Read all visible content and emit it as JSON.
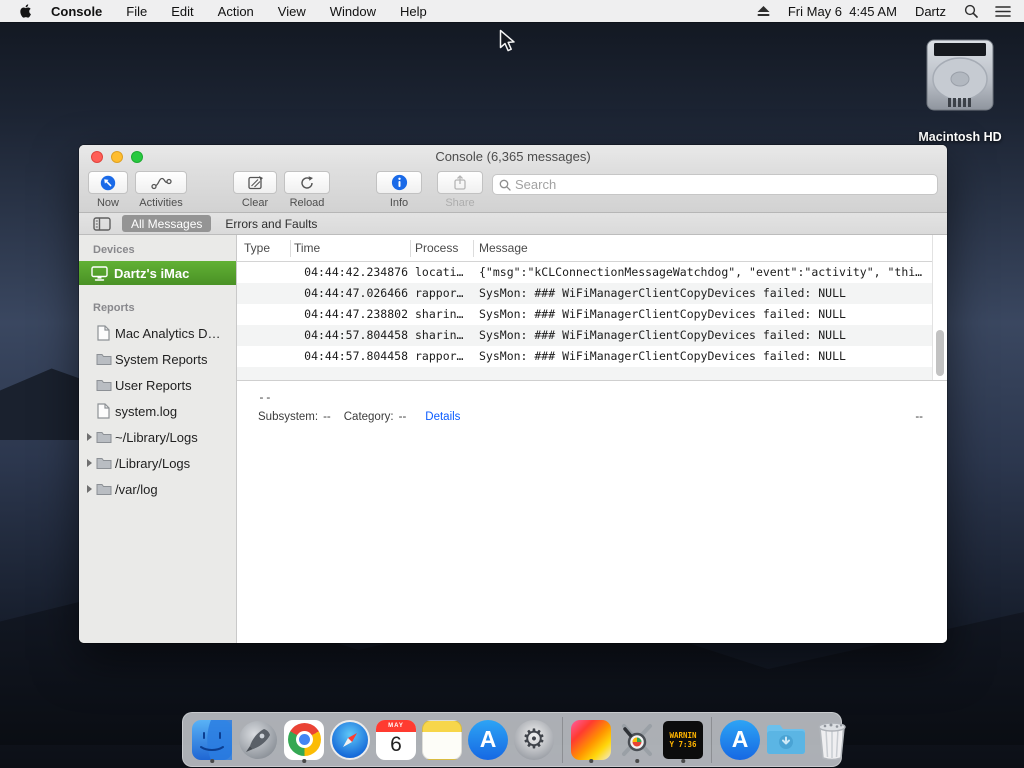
{
  "menu_bar": {
    "app_name": "Console",
    "menus": [
      "File",
      "Edit",
      "Action",
      "View",
      "Window",
      "Help"
    ],
    "status": {
      "clock": "Fri May 6  4:45 AM",
      "user": "Dartz"
    }
  },
  "desktop": {
    "volume_label": "Macintosh HD"
  },
  "window": {
    "title": "Console (6,365 messages)",
    "toolbar": {
      "now": "Now",
      "activities": "Activities",
      "clear": "Clear",
      "reload": "Reload",
      "info": "Info",
      "share": "Share",
      "search_placeholder": "Search"
    },
    "tabs": {
      "all": "All Messages",
      "errors": "Errors and Faults"
    },
    "sidebar": {
      "devices_header": "Devices",
      "device": "Dartz's iMac",
      "reports_header": "Reports",
      "items": [
        "Mac Analytics D…",
        "System Reports",
        "User Reports",
        "system.log",
        "~/Library/Logs",
        "/Library/Logs",
        "/var/log"
      ]
    },
    "table": {
      "columns": [
        "Type",
        "Time",
        "Process",
        "Message"
      ],
      "rows": [
        {
          "type": "",
          "time": "04:44:42.234876",
          "process": "locati…",
          "message": "{\"msg\":\"kCLConnectionMessageWatchdog\", \"event\":\"activity\", \"thi…"
        },
        {
          "type": "",
          "time": "04:44:47.026466",
          "process": "rappor…",
          "message": "SysMon: ### WiFiManagerClientCopyDevices failed: NULL"
        },
        {
          "type": "",
          "time": "04:44:47.238802",
          "process": "sharin…",
          "message": "SysMon: ### WiFiManagerClientCopyDevices failed: NULL"
        },
        {
          "type": "",
          "time": "04:44:57.804458",
          "process": "sharin…",
          "message": "SysMon: ### WiFiManagerClientCopyDevices failed: NULL"
        },
        {
          "type": "",
          "time": "04:44:57.804458",
          "process": "rappor…",
          "message": "SysMon: ### WiFiManagerClientCopyDevices failed: NULL"
        }
      ]
    },
    "details": {
      "summary": "--",
      "subsystem_label": "Subsystem:",
      "subsystem_value": "--",
      "category_label": "Category:",
      "category_value": "--",
      "details_link": "Details",
      "right_value": "--"
    }
  },
  "dock": {
    "items": [
      "finder",
      "launchpad",
      "chrome",
      "safari",
      "calendar",
      "notes",
      "app-store",
      "system-preferences",
      "colorsync",
      "diagnostics",
      "warning-display",
      "applications",
      "downloads",
      "trash"
    ],
    "calendar": {
      "month": "MAY",
      "day": "6"
    },
    "warning_display": {
      "line1": "WARNIN",
      "line2": "Y 7:36"
    }
  },
  "colors": {
    "selection_green": "#4f9b2d",
    "link_blue": "#0b5cff",
    "tab_pill_gray": "#949494",
    "warning_amber": "#ffb400",
    "accent_blue": "#1a6ae8"
  }
}
